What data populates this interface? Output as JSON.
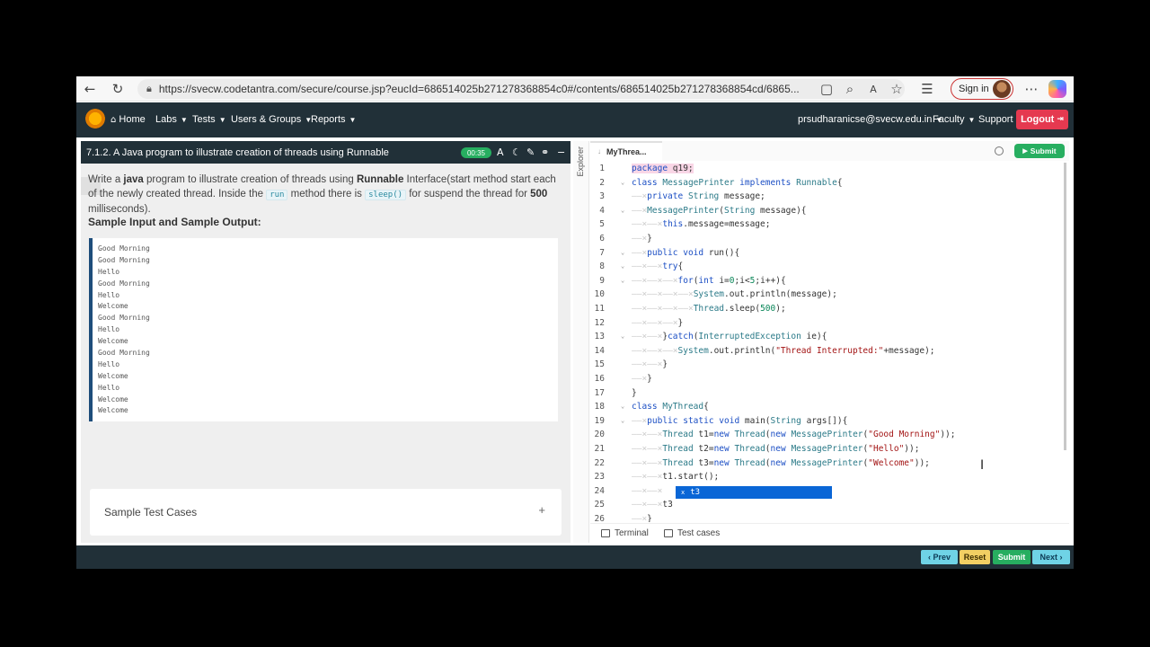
{
  "browser": {
    "url": "https://svecw.codetantra.com/secure/course.jsp?eucId=686514025b271278368854c0#/contents/686514025b271278368854cd/6865...",
    "signin_label": "Sign in"
  },
  "navbar": {
    "home": "Home",
    "labs": "Labs",
    "tests": "Tests",
    "users_groups": "Users & Groups",
    "reports": "Reports",
    "user_email": "prsudharanicse@svecw.edu.in",
    "faculty": "Faculty",
    "support": "Support",
    "logout": "Logout"
  },
  "question": {
    "title": "7.1.2. A Java program to illustrate creation of threads using Runnable",
    "timer": "00:35",
    "desc_1": "Write a ",
    "desc_java": "java",
    "desc_2": " program to illustrate creation of threads using ",
    "desc_runnable": "Runnable",
    "desc_3": " Interface(start method start each of the newly created thread. Inside the ",
    "desc_run": "run",
    "desc_4": " method there is ",
    "desc_sleep": "sleep()",
    "desc_5": " for suspend the thread for ",
    "desc_500": "500",
    "desc_6": " milliseconds).",
    "sample_title": "Sample Input and Sample Output:",
    "sample_output": [
      "Good Morning",
      "Good Morning",
      "Hello",
      "Good Morning",
      "Hello",
      "Welcome",
      "Good Morning",
      "Hello",
      "Welcome",
      "Good Morning",
      "Hello",
      "Welcome",
      "Hello",
      "Welcome",
      "Welcome"
    ],
    "test_cases_label": "Sample Test Cases"
  },
  "editor": {
    "explorer_label": "Explorer",
    "file_tab": "MyThrea...",
    "submit_label": "Submit",
    "autocomplete_item": "t3",
    "lines": [
      "package q19;",
      "class MessagePrinter implements Runnable{",
      "private String message;",
      "MessagePrinter(String message){",
      "this.message=message;",
      "}",
      "public void run(){",
      "try{",
      "for(int i=0;i<5;i++){",
      "System.out.println(message);",
      "Thread.sleep(500);",
      "}",
      "}catch(InterruptedException ie){",
      "System.out.println(\"Thread Interrupted:\"+message);",
      "}",
      "}",
      "}",
      "class MyThread{",
      "public static void main(String args[]){",
      "Thread t1=new Thread(new MessagePrinter(\"Good Morning\"));",
      "Thread t2=new Thread(new MessagePrinter(\"Hello\"));",
      "Thread t3=new Thread(new MessagePrinter(\"Welcome\"));",
      "t1.start();",
      "",
      "t3",
      "}"
    ],
    "terminal_label": "Terminal",
    "testcases_label": "Test cases"
  },
  "footer": {
    "prev": "‹ Prev",
    "reset": "Reset",
    "submit": "Submit",
    "next": "Next ›"
  }
}
